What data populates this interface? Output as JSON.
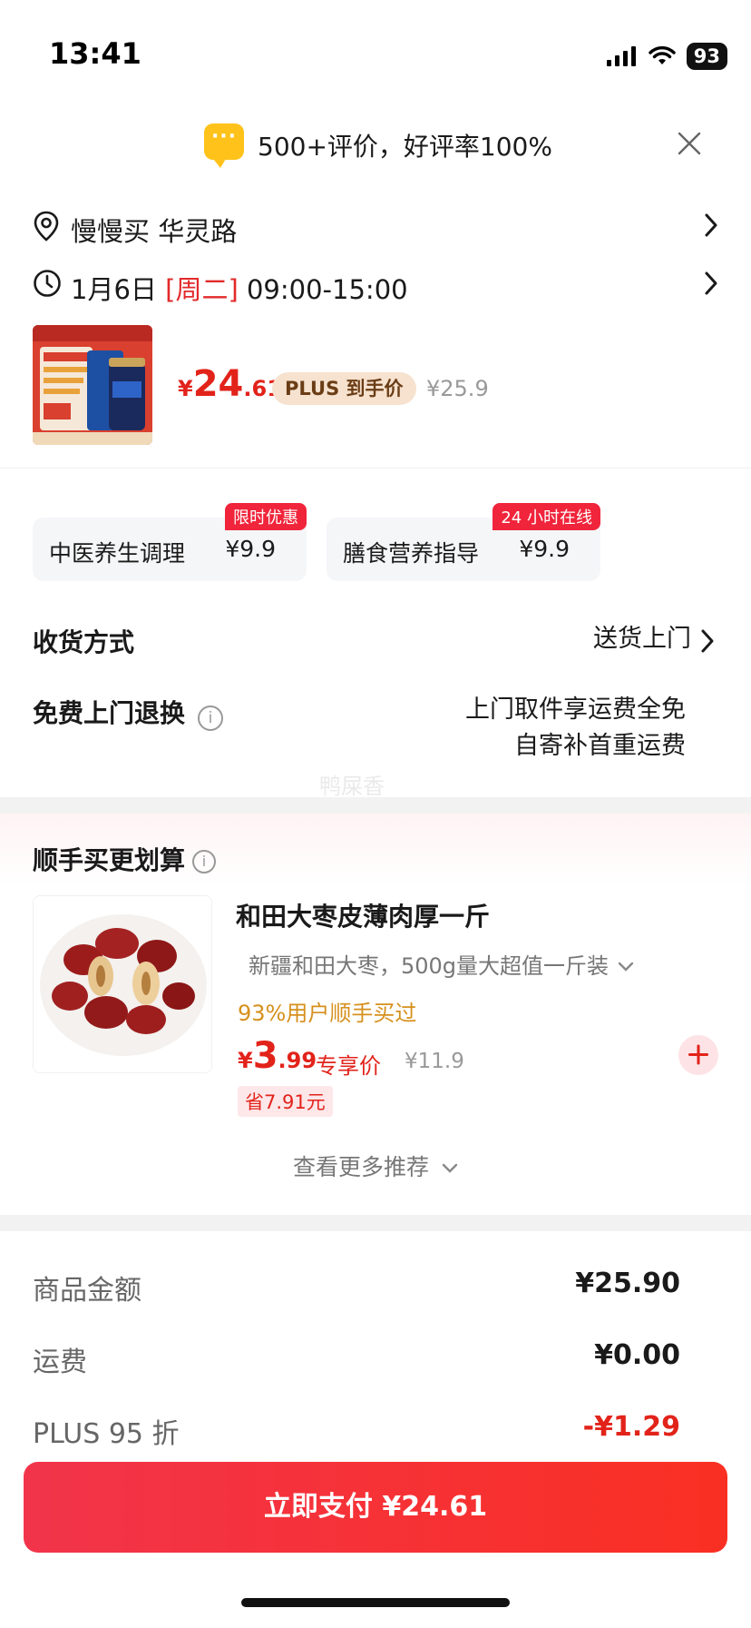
{
  "status_bar": {
    "time": "13:41",
    "battery": "93"
  },
  "review": {
    "text": "500+评价，好评率100%"
  },
  "address": {
    "text": "慢慢买 华灵路"
  },
  "delivery_time": {
    "date": "1月6日",
    "weekday": "[周二]",
    "slot": "09:00-15:00"
  },
  "product": {
    "price_symbol": "¥",
    "price_int": "24",
    "price_dec": ".61",
    "plus_tag": "PLUS 到手价",
    "original_price": "¥25.9"
  },
  "services": [
    {
      "name": "中医养生调理",
      "price": "¥9.9",
      "badge": "限时优惠"
    },
    {
      "name": "膳食营养指导",
      "price": "¥9.9",
      "badge": "24 小时在线"
    }
  ],
  "shipping": {
    "label": "收货方式",
    "value": "送货上门"
  },
  "returns": {
    "label": "免费上门退换",
    "line1": "上门取件享运费全免",
    "line2": "自寄补首重运费"
  },
  "watermark": "鸭屎香",
  "recommend": {
    "title": "顺手买更划算",
    "name": "和田大枣皮薄肉厚一斤",
    "spec": "新疆和田大枣，500g量大超值一斤装",
    "buy_text": "93%用户顺手买过",
    "price_symbol": "¥",
    "price_int": "3",
    "price_dec": ".99",
    "exclusive": "专享价",
    "original_price": "¥11.9",
    "save": "省7.91元",
    "more": "查看更多推荐"
  },
  "summary": [
    {
      "label": "商品金额",
      "value": "¥25.90"
    },
    {
      "label": "运费",
      "value": "¥0.00"
    },
    {
      "label": "PLUS 95 折",
      "value": "-¥1.29"
    }
  ],
  "pay_button": {
    "label": "立即支付 ¥24.61"
  },
  "colors": {
    "accent_red": "#e2231a",
    "pay_gradient_start": "#f2344b",
    "pay_gradient_end": "#fa2f23",
    "plus_tag_bg": "#f6e2cf",
    "review_bubble": "#ffc21a"
  }
}
